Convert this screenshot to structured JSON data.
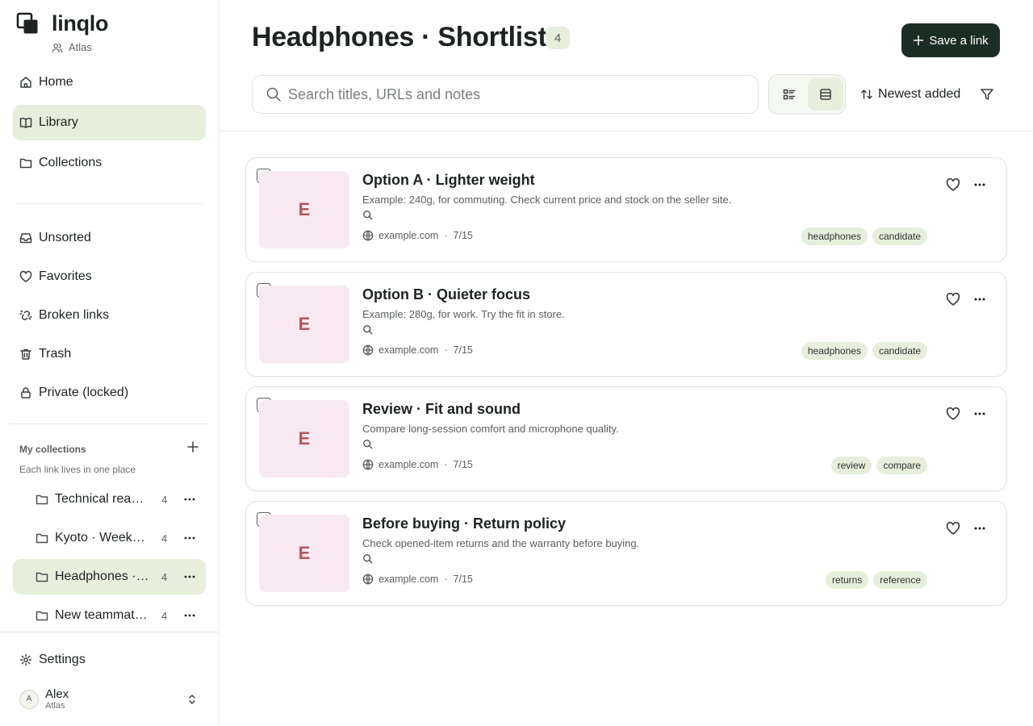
{
  "brand": {
    "name": "linqlo",
    "workspace": "Atlas"
  },
  "nav": {
    "primary": [
      {
        "label": "Home",
        "icon": "home-icon",
        "active": false
      },
      {
        "label": "Library",
        "icon": "book-icon",
        "active": true
      },
      {
        "label": "Collections",
        "icon": "folder-icon",
        "active": false
      }
    ],
    "secondary": [
      {
        "label": "Unsorted",
        "icon": "inbox-icon"
      },
      {
        "label": "Favorites",
        "icon": "heart-icon"
      },
      {
        "label": "Broken links",
        "icon": "broken-link-icon"
      },
      {
        "label": "Trash",
        "icon": "trash-icon"
      },
      {
        "label": "Private (locked)",
        "icon": "lock-icon"
      }
    ]
  },
  "collections": {
    "heading": "My collections",
    "subtitle": "Each link lives in one place",
    "items": [
      {
        "label": "Technical reading",
        "count": "4",
        "active": false
      },
      {
        "label": "Kyoto · Weekend trip",
        "count": "4",
        "active": false
      },
      {
        "label": "Headphones · Shortlist",
        "count": "4",
        "active": true
      },
      {
        "label": "New teammate onboarding",
        "count": "4",
        "active": false
      }
    ]
  },
  "footer": {
    "settings_label": "Settings",
    "user_name": "Alex",
    "user_workspace": "Atlas",
    "avatar_initial": "A"
  },
  "header": {
    "title": "Headphones · Shortlist",
    "count": "4",
    "save_label": "Save a link",
    "search_placeholder": "Search titles, URLs and notes",
    "sort_label": "Newest added"
  },
  "links": [
    {
      "initial": "E",
      "title": "Option A · Lighter weight",
      "description": "Example: 240g, for commuting. Check current price and stock on the seller site.",
      "domain": "example.com",
      "date": "7/15",
      "tags": [
        "headphones",
        "candidate"
      ]
    },
    {
      "initial": "E",
      "title": "Option B · Quieter focus",
      "description": "Example: 280g, for work. Try the fit in store.",
      "domain": "example.com",
      "date": "7/15",
      "tags": [
        "headphones",
        "candidate"
      ]
    },
    {
      "initial": "E",
      "title": "Review · Fit and sound",
      "description": "Compare long-session comfort and microphone quality.",
      "domain": "example.com",
      "date": "7/15",
      "tags": [
        "review",
        "compare"
      ]
    },
    {
      "initial": "E",
      "title": "Before buying · Return policy",
      "description": "Check opened-item returns and the warranty before buying.",
      "domain": "example.com",
      "date": "7/15",
      "tags": [
        "returns",
        "reference"
      ]
    }
  ],
  "colors": {
    "accent": "#e6efdb",
    "primary_button": "#1b2e25",
    "thumb_bg": "#f8e8f1",
    "thumb_letter": "#b3575a"
  }
}
